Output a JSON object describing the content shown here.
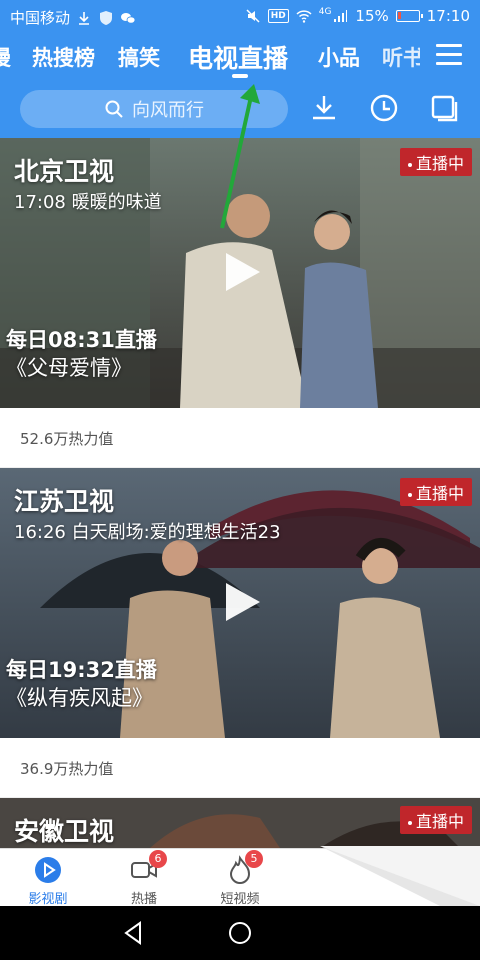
{
  "status_bar": {
    "carrier": "中国移动",
    "signal_label": "4G",
    "battery": "15%",
    "battery_level": 0.15,
    "time": "17:10"
  },
  "tabs": [
    "漫",
    "热搜榜",
    "搞笑",
    "电视直播",
    "小品",
    "听书"
  ],
  "active_tab": "电视直播",
  "search": {
    "placeholder": "向风而行"
  },
  "cards": [
    {
      "channel": "北京卫视",
      "now_playing": "17:08 暖暖的味道",
      "live_badge": "直播中",
      "schedule": "每日08:31直播",
      "show": "《父母爱情》",
      "heat": "52.6万热力值"
    },
    {
      "channel": "江苏卫视",
      "now_playing": "16:26 白天剧场:爱的理想生活23",
      "live_badge": "直播中",
      "schedule": "每日19:32直播",
      "show": "《纵有疾风起》",
      "heat": "36.9万热力值"
    },
    {
      "channel": "安徽卫视",
      "live_badge": "直播中"
    }
  ],
  "bottom_nav": [
    {
      "label": "影视剧",
      "icon": "play-circle-icon",
      "active": true
    },
    {
      "label": "热播",
      "icon": "video-camera-icon",
      "badge": "6"
    },
    {
      "label": "短视频",
      "icon": "flame-icon",
      "badge": "5"
    }
  ],
  "colors": {
    "header_blue": "#3b93f0",
    "live_red": "#c0262b",
    "accent_blue": "#2b7de9",
    "annotation_green": "#22a83a"
  }
}
